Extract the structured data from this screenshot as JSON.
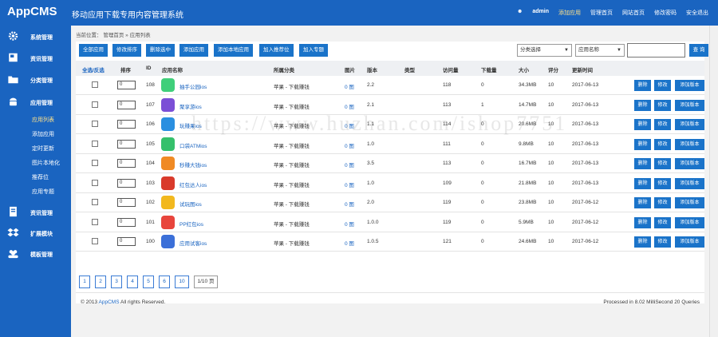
{
  "header": {
    "logo": "AppCMS",
    "system_title": "移动应用下载专用内容管理系统",
    "user": "admin",
    "nav": [
      "添加应用",
      "管理首页",
      "网站首页",
      "修改密码",
      "安全退出"
    ]
  },
  "sidebar": {
    "sections": [
      {
        "label": "系统管理",
        "icon": "gear-icon"
      },
      {
        "label": "资讯管理",
        "icon": "book-icon"
      },
      {
        "label": "分类管理",
        "icon": "folder-icon"
      },
      {
        "label": "应用管理",
        "icon": "android-icon"
      }
    ],
    "subitems": [
      "应用列表",
      "添加应用",
      "定时更新",
      "图片本地化",
      "推荐位",
      "应用专题"
    ],
    "sections2": [
      {
        "label": "资讯管理",
        "icon": "document-icon"
      },
      {
        "label": "扩展模块",
        "icon": "dropbox-icon"
      },
      {
        "label": "模板管理",
        "icon": "users-icon"
      }
    ]
  },
  "breadcrumb": {
    "prefix": "当前位置：",
    "items": [
      "管理首页",
      "应用列表"
    ],
    "sep": "»"
  },
  "toolbar": {
    "buttons": [
      "全部应用",
      "修改排序",
      "删除选中",
      "添加应用",
      "添加本地应用",
      "加入推荐位",
      "加入专题"
    ],
    "category_select": "分类选择",
    "field_select": "应用名称",
    "search_value": "",
    "query_button": "查 询"
  },
  "table": {
    "headers": {
      "select": "全选/反选",
      "sort": "排序",
      "id": "ID",
      "name": "应用名称",
      "category": "所属分类",
      "images": "图片",
      "version": "版本",
      "type": "类型",
      "views": "访问量",
      "downloads": "下载量",
      "size": "大小",
      "rating": "评分",
      "updated": "更新时间"
    },
    "actions": [
      "删除",
      "修改",
      "添加版本"
    ],
    "rows": [
      {
        "sort": "0",
        "id": "108",
        "name": "抽手公园ios",
        "category": "苹果 - 下载赚钱",
        "images": "0 图",
        "version": "2.2",
        "type": "",
        "views": "118",
        "downloads": "0",
        "size": "34.3MB",
        "rating": "10",
        "updated": "2017-06-13",
        "icon_color": "#3fcf7a"
      },
      {
        "sort": "0",
        "id": "107",
        "name": "聚享游ios",
        "category": "苹果 - 下载赚钱",
        "images": "0 图",
        "version": "2.1",
        "type": "",
        "views": "113",
        "downloads": "1",
        "size": "14.7MB",
        "rating": "10",
        "updated": "2017-06-13",
        "icon_color": "#7b4fd6"
      },
      {
        "sort": "0",
        "id": "106",
        "name": "玩赚果ios",
        "category": "苹果 - 下载赚钱",
        "images": "0 图",
        "version": "1.1",
        "type": "",
        "views": "114",
        "downloads": "0",
        "size": "20.6MB",
        "rating": "10",
        "updated": "2017-06-13",
        "icon_color": "#2a8fe0"
      },
      {
        "sort": "0",
        "id": "105",
        "name": "口袋ATMios",
        "category": "苹果 - 下载赚钱",
        "images": "0 图",
        "version": "1.0",
        "type": "",
        "views": "111",
        "downloads": "0",
        "size": "9.8MB",
        "rating": "10",
        "updated": "2017-06-13",
        "icon_color": "#35c06b"
      },
      {
        "sort": "0",
        "id": "104",
        "name": "秒赚大钱ios",
        "category": "苹果 - 下载赚钱",
        "images": "0 图",
        "version": "3.5",
        "type": "",
        "views": "113",
        "downloads": "0",
        "size": "16.7MB",
        "rating": "10",
        "updated": "2017-06-13",
        "icon_color": "#f08a24"
      },
      {
        "sort": "0",
        "id": "103",
        "name": "红包达人ios",
        "category": "苹果 - 下载赚钱",
        "images": "0 图",
        "version": "1.0",
        "type": "",
        "views": "109",
        "downloads": "0",
        "size": "21.8MB",
        "rating": "10",
        "updated": "2017-06-13",
        "icon_color": "#d93a2b"
      },
      {
        "sort": "0",
        "id": "102",
        "name": "试玩图ios",
        "category": "苹果 - 下载赚钱",
        "images": "0 图",
        "version": "2.0",
        "type": "",
        "views": "119",
        "downloads": "0",
        "size": "23.8MB",
        "rating": "10",
        "updated": "2017-06-12",
        "icon_color": "#f2b81e"
      },
      {
        "sort": "0",
        "id": "101",
        "name": "PP红包ios",
        "category": "苹果 - 下载赚钱",
        "images": "0 图",
        "version": "1.0.0",
        "type": "",
        "views": "119",
        "downloads": "0",
        "size": "5.9MB",
        "rating": "10",
        "updated": "2017-06-12",
        "icon_color": "#e8453c"
      },
      {
        "sort": "0",
        "id": "100",
        "name": "应用试客ios",
        "category": "苹果 - 下载赚钱",
        "images": "0 图",
        "version": "1.0.5",
        "type": "",
        "views": "121",
        "downloads": "0",
        "size": "24.6MB",
        "rating": "10",
        "updated": "2017-06-12",
        "icon_color": "#3b6fd8"
      }
    ]
  },
  "pagination": {
    "pages": [
      "1",
      "2",
      "3",
      "4",
      "5",
      "6",
      "10"
    ],
    "info": "1/10 页"
  },
  "footer": {
    "copyright_prefix": "© 2013 ",
    "brand": "AppCMS",
    "copyright_suffix": " All rights Reserved.",
    "processed": "Processed in 8.02 MilliSecond 20 Queries"
  },
  "watermark": "https://www.huzhan.com/ishop7751"
}
